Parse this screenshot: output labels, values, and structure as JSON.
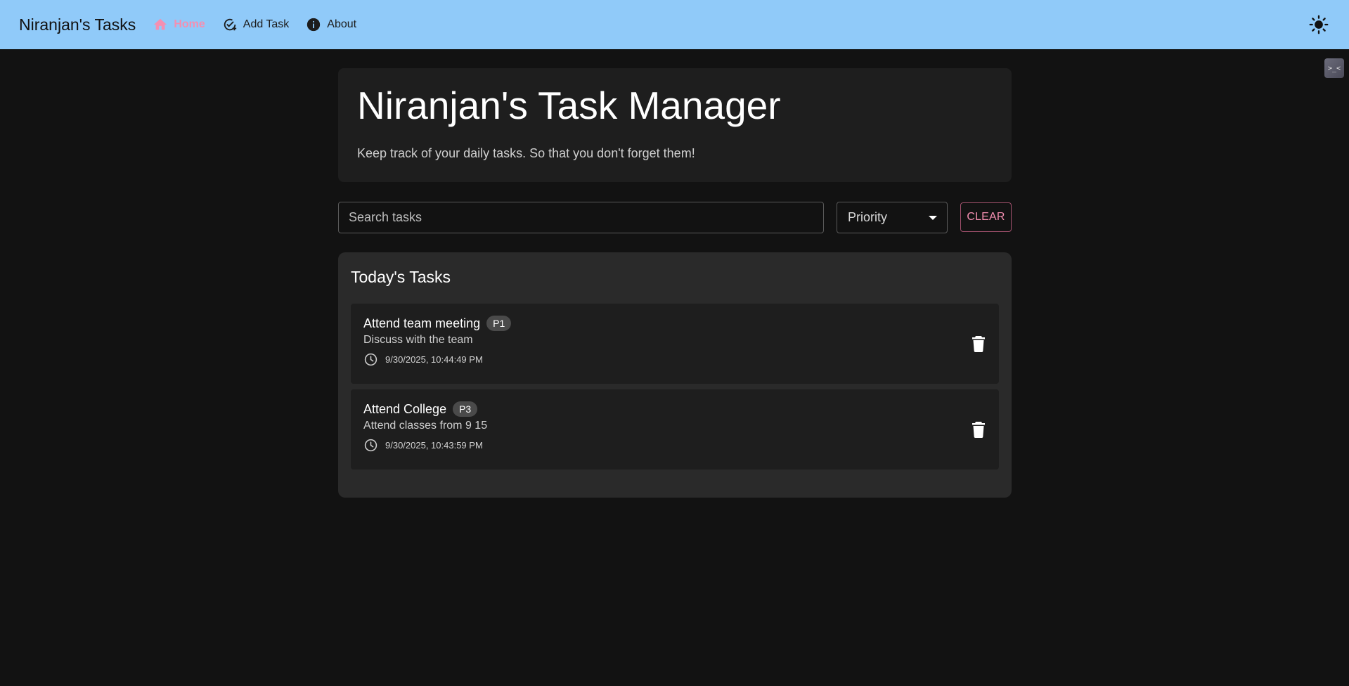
{
  "appbar": {
    "brand": "Niranjan's Tasks",
    "nav": [
      {
        "label": "Home",
        "icon": "home-icon",
        "active": true
      },
      {
        "label": "Add Task",
        "icon": "add-task-icon",
        "active": false
      },
      {
        "label": "About",
        "icon": "info-icon",
        "active": false
      }
    ],
    "theme_toggle_icon": "sun-icon"
  },
  "extension_icon_text": ">_<",
  "hero": {
    "title": "Niranjan's Task Manager",
    "subtitle": "Keep track of your daily tasks. So that you don't forget them!"
  },
  "filters": {
    "search_placeholder": "Search tasks",
    "search_value": "",
    "priority_label": "Priority",
    "clear_label": "CLEAR"
  },
  "tasks": {
    "heading": "Today's Tasks",
    "items": [
      {
        "title": "Attend team meeting",
        "priority": "P1",
        "description": "Discuss with the team",
        "timestamp": "9/30/2025, 10:44:49 PM"
      },
      {
        "title": "Attend College",
        "priority": "P3",
        "description": "Attend classes from 9 15",
        "timestamp": "9/30/2025, 10:43:59 PM"
      }
    ]
  },
  "colors": {
    "appbar": "#90caf9",
    "background": "#121212",
    "accent": "#f48fb1",
    "card": "#1e1e1e",
    "panel": "#2a2a2a"
  }
}
